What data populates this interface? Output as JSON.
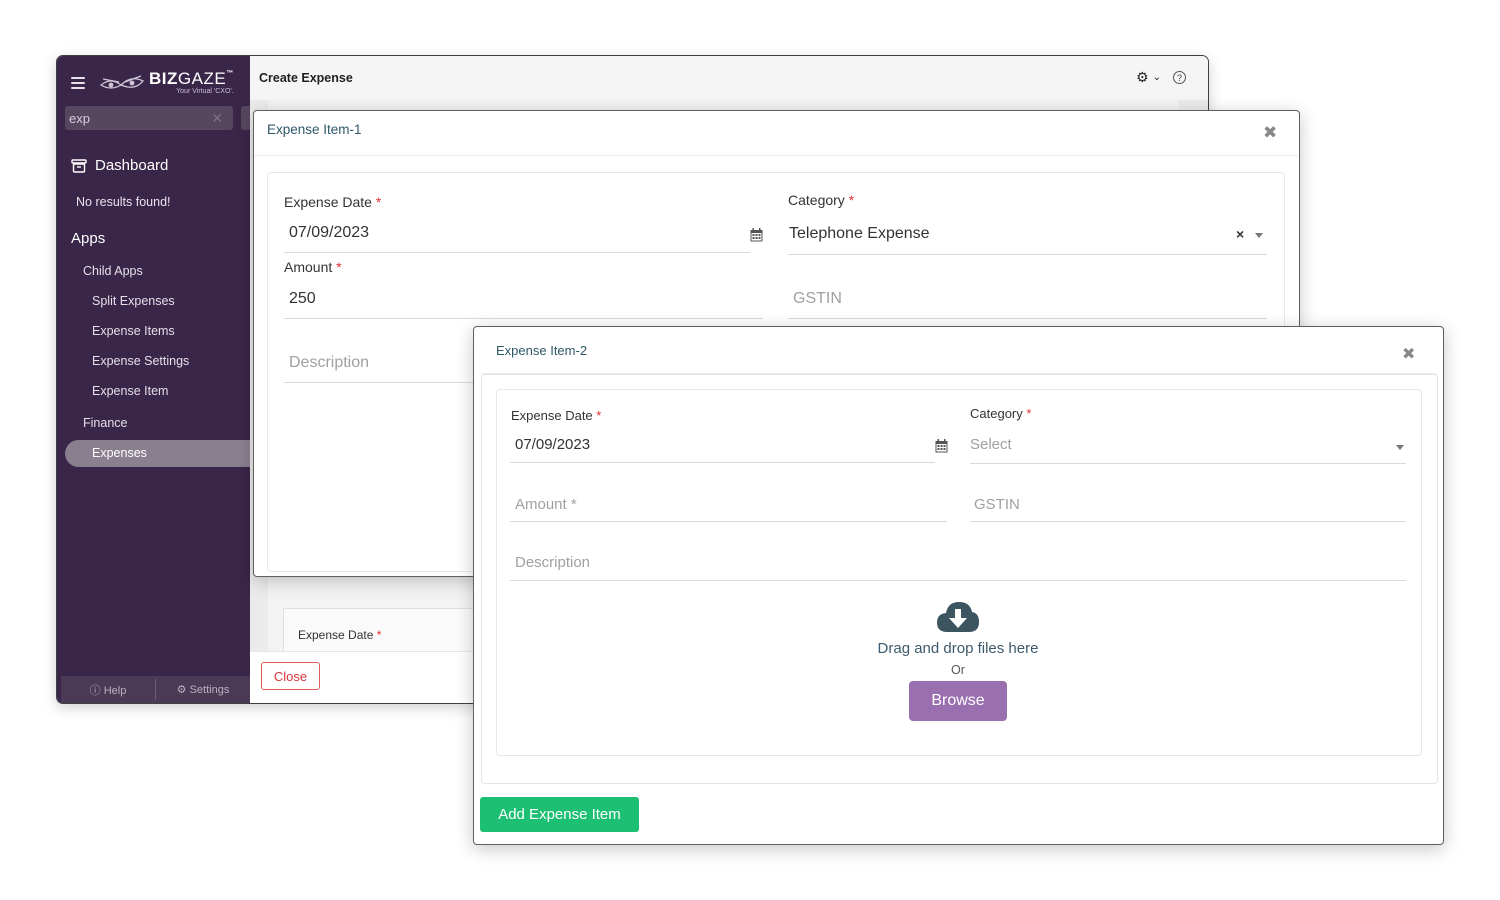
{
  "app": {
    "logo_text_bold": "BIZ",
    "logo_text_thin": "GAZE",
    "logo_tm": "™",
    "logo_tagline": "Your Virtual 'CXO'.",
    "page_title": "Create Expense",
    "header_help_glyph": "?"
  },
  "sidebar": {
    "search_value": "exp",
    "search_clear": "✕",
    "dashboard_label": "Dashboard",
    "no_results": "No results found!",
    "apps_heading": "Apps",
    "child_apps": "Child Apps",
    "items": [
      "Split Expenses",
      "Expense Items",
      "Expense Settings",
      "Expense Item"
    ],
    "finance": "Finance",
    "active_item": "Expenses",
    "footer_help": "ⓘ Help",
    "footer_settings": "⚙ Settings"
  },
  "background": {
    "expense_date_label": "Expense Date",
    "close_button": "Close"
  },
  "dialog1": {
    "title": "Expense Item-1",
    "close": "✖",
    "expense_date_label": "Expense Date",
    "expense_date_value": "07/09/2023",
    "category_label": "Category",
    "category_value": "Telephone Expense",
    "category_clear": "×",
    "amount_label": "Amount",
    "amount_value": "250",
    "gstin_placeholder": "GSTIN",
    "description_placeholder": "Description"
  },
  "dialog2": {
    "title": "Expense Item-2",
    "close": "✖",
    "expense_date_label": "Expense Date",
    "expense_date_value": "07/09/2023",
    "category_label": "Category",
    "category_placeholder": "Select",
    "amount_placeholder": "Amount *",
    "gstin_placeholder": "GSTIN",
    "description_placeholder": "Description",
    "drop_text": "Drag and drop files here",
    "or_text": "Or",
    "browse_button": "Browse",
    "add_button": "Add Expense Item"
  },
  "required_mark": "*",
  "colors": {
    "sidebar_bg": "#3a2648",
    "browse_bg": "#9a6fb0",
    "add_bg": "#1dbf73",
    "required": "#e03131",
    "title_teal": "#2e5868"
  },
  "icons": [
    "hamburger-icon",
    "logo-eyes-icon",
    "dashboard-icon",
    "gear-icon",
    "chevron-down-icon",
    "help-icon",
    "calendar-icon",
    "close-icon",
    "cloud-download-icon",
    "caret-down-icon"
  ]
}
